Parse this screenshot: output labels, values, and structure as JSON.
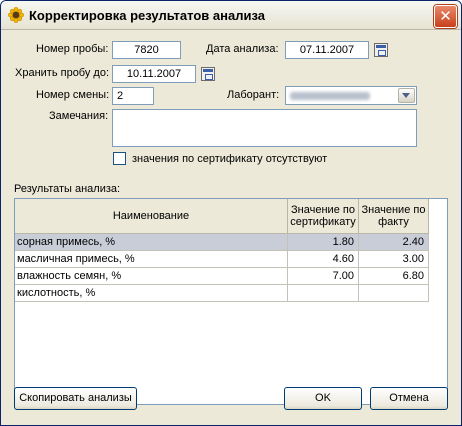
{
  "window": {
    "title": "Корректировка результатов анализа"
  },
  "form": {
    "sample_number_label": "Номер пробы:",
    "sample_number_value": "7820",
    "analysis_date_label": "Дата анализа:",
    "analysis_date_value": "07.11.2007",
    "store_until_label": "Хранить пробу до:",
    "store_until_value": "10.11.2007",
    "shift_number_label": "Номер смены:",
    "shift_number_value": "2",
    "lab_label": "Лаборант:",
    "remarks_label": "Замечания:",
    "no_cert_values_label": "значения по сертификату отсутствуют",
    "no_cert_values_checked": false
  },
  "results": {
    "section_label": "Результаты анализа:",
    "columns": [
      "Наименование",
      "Значение по\nсертификату",
      "Значение по\nфакту"
    ],
    "rows": [
      {
        "name": "сорная примесь, %",
        "cert": "1.80",
        "fact": "2.40",
        "selected": true
      },
      {
        "name": "масличная примесь, %",
        "cert": "4.60",
        "fact": "3.00",
        "selected": false
      },
      {
        "name": "влажность семян, %",
        "cert": "7.00",
        "fact": "6.80",
        "selected": false
      },
      {
        "name": "кислотность, %",
        "cert": "",
        "fact": "",
        "selected": false
      }
    ]
  },
  "buttons": {
    "copy_label": "Скопировать анализы",
    "ok_label": "OK",
    "cancel_label": "Отмена"
  }
}
